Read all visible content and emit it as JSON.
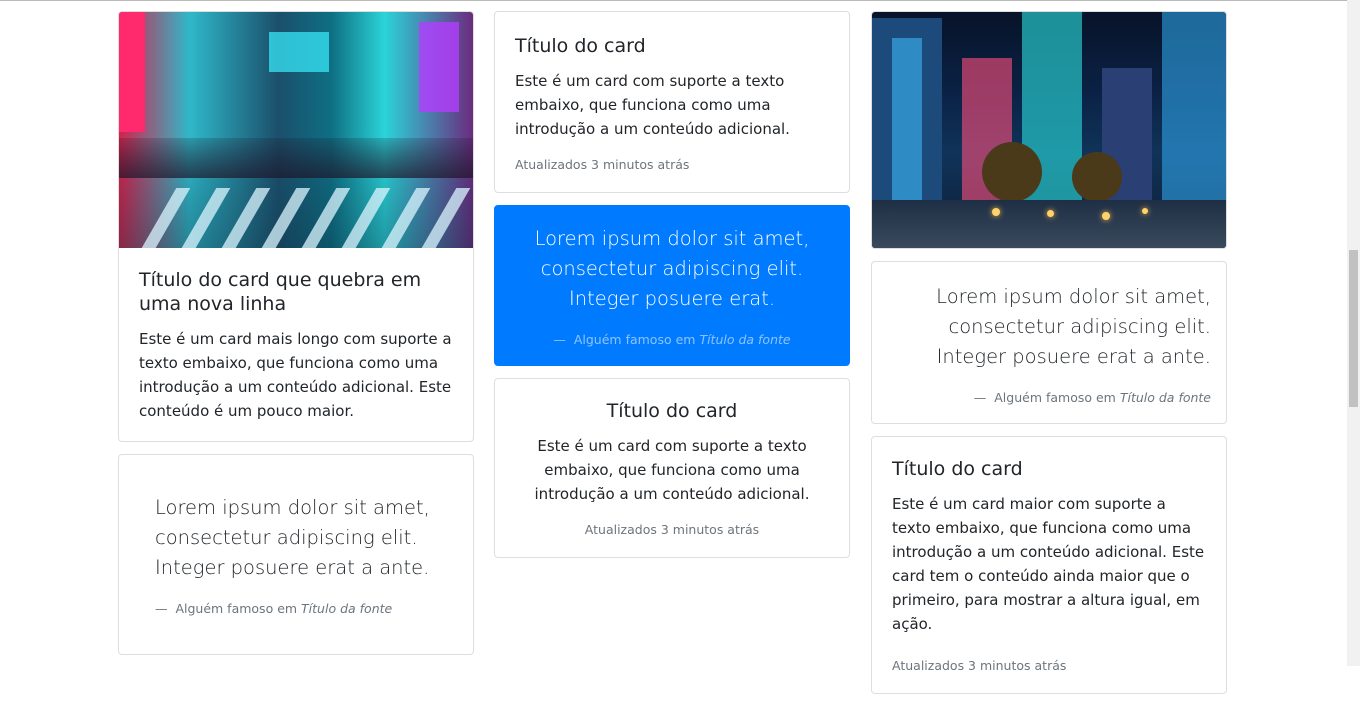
{
  "col1": {
    "card1": {
      "title": "Título do card que quebra em uma nova linha",
      "text": "Este é um card mais longo com suporte a texto embaixo, que funciona como uma introdução a um conteúdo adicional. Este conteúdo é um pouco maior."
    },
    "quote1": {
      "text": "Lorem ipsum dolor sit amet, consectetur adipiscing elit. Integer posuere erat a ante.",
      "footer_prefix": "Alguém famoso em",
      "footer_source": "Título da fonte"
    }
  },
  "col2": {
    "card1": {
      "title": "Título do card",
      "text": "Este é um card com suporte a texto embaixo, que funciona como uma introdução a um conteúdo adicional.",
      "updated": "Atualizados 3 minutos atrás"
    },
    "quote_primary": {
      "text": "Lorem ipsum dolor sit amet, consectetur adipiscing elit. Integer posuere erat.",
      "footer_prefix": "Alguém famoso em",
      "footer_source": "Título da fonte"
    },
    "card2": {
      "title": "Título do card",
      "text": "Este é um card com suporte a texto embaixo, que funciona como uma introdução a um conteúdo adicional.",
      "updated": "Atualizados 3 minutos atrás"
    }
  },
  "col3": {
    "quote1": {
      "text": "Lorem ipsum dolor sit amet, consectetur adipiscing elit. Integer posuere erat a ante.",
      "footer_prefix": "Alguém famoso em",
      "footer_source": "Título da fonte"
    },
    "card1": {
      "title": "Título do card",
      "text": "Este é um card maior com suporte a texto embaixo, que funciona como uma introdução a um conteúdo adicional. Este card tem o conteúdo ainda maior que o primeiro, para mostrar a altura igual, em ação.",
      "updated": "Atualizados 3 minutos atrás"
    }
  },
  "colors": {
    "primary": "#007bff",
    "muted": "#6c757d",
    "text": "#212529"
  }
}
